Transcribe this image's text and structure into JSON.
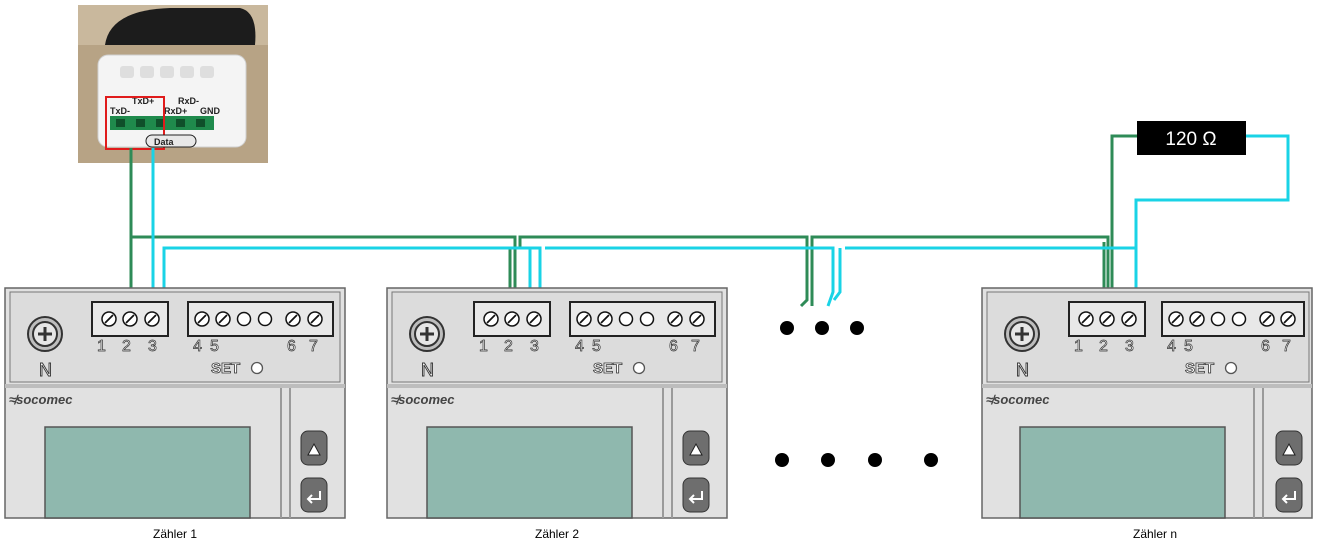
{
  "adapter": {
    "labels": {
      "txd_plus": "TxD+",
      "rxd_minus": "RxD-",
      "txd_minus": "TxD-",
      "rxd_plus": "RxD+",
      "gnd": "GND",
      "data": "Data"
    }
  },
  "resistor": {
    "label": "120 Ω"
  },
  "meters": [
    {
      "caption": "Zähler 1"
    },
    {
      "caption": "Zähler 2"
    },
    {
      "caption": "Zähler n"
    }
  ],
  "meter_labels": {
    "brand": "≉socomec",
    "neutral": "N",
    "set": "SET",
    "terminal_numbers": [
      "1",
      "2",
      "3",
      "4",
      "5",
      "6",
      "7"
    ]
  },
  "colors": {
    "wire_green": "#2e8b57",
    "wire_cyan": "#19d3e6",
    "meter_body": "#e1e1e1",
    "meter_outline": "#555555",
    "screen": "#8fb8ae",
    "resistor_bg": "#000000",
    "highlight": "#e01b1b"
  },
  "icons": {
    "up_button": "up-arrow-icon",
    "enter_button": "enter-icon",
    "screw": "screw-icon"
  }
}
